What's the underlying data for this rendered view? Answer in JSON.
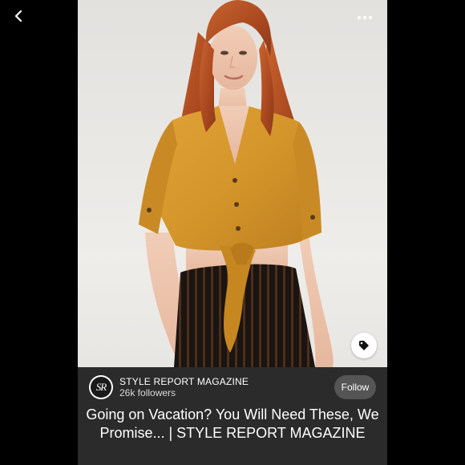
{
  "nav": {
    "back_icon": "chevron-left-icon"
  },
  "pin": {
    "more_icon": "more-horizontal-icon",
    "tag_icon": "tag-icon",
    "image_alt": "Woman in mustard tie-front crop top and striped skirt"
  },
  "profile": {
    "avatar_text": "SR",
    "name": "STYLE REPORT MAGAZINE",
    "followers": "26k followers",
    "follow_label": "Follow"
  },
  "title": "Going on Vacation? You Will Need These, We Promise... | STYLE REPORT MAGAZINE",
  "colors": {
    "background": "#000000",
    "card": "#2b2b2b",
    "follow_button": "#555555",
    "text": "#ffffff",
    "blouse": "#d99a2b",
    "hair": "#b8552a"
  }
}
